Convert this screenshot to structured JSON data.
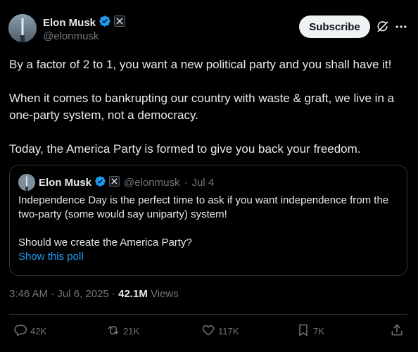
{
  "author": {
    "name": "Elon Musk",
    "handle": "@elonmusk",
    "verified": true,
    "affiliate_badge": "x-logo-icon"
  },
  "header": {
    "subscribe_label": "Subscribe",
    "icons": [
      "grok-icon",
      "more-icon"
    ]
  },
  "tweet": {
    "line1": "By a factor of 2 to 1, you want a new political party and you shall have it!",
    "line2": "When it comes to bankrupting our country with waste & graft, we live in a one-party system, not a democracy.",
    "line3": "Today, the America Party is formed to give you back your freedom."
  },
  "quote": {
    "name": "Elon Musk",
    "handle": "@elonmusk",
    "separator": "·",
    "date": "Jul 4",
    "line1": "Independence Day is the perfect time to ask if you want independence from the two-party (some would say uniparty) system!",
    "line2": "Should we create the America Party?",
    "poll_link": "Show this poll"
  },
  "meta": {
    "time": "3:46 AM",
    "separator": "·",
    "date": "Jul 6, 2025",
    "views_count": "42.1M",
    "views_label": "Views"
  },
  "actions": {
    "replies": "42K",
    "reposts": "21K",
    "likes": "117K",
    "bookmarks": "7K"
  },
  "colors": {
    "background": "#000000",
    "text": "#e7e9ea",
    "muted": "#71767b",
    "link": "#1d9bf0",
    "verified": "#1d9bf0",
    "border": "#2f3336"
  }
}
